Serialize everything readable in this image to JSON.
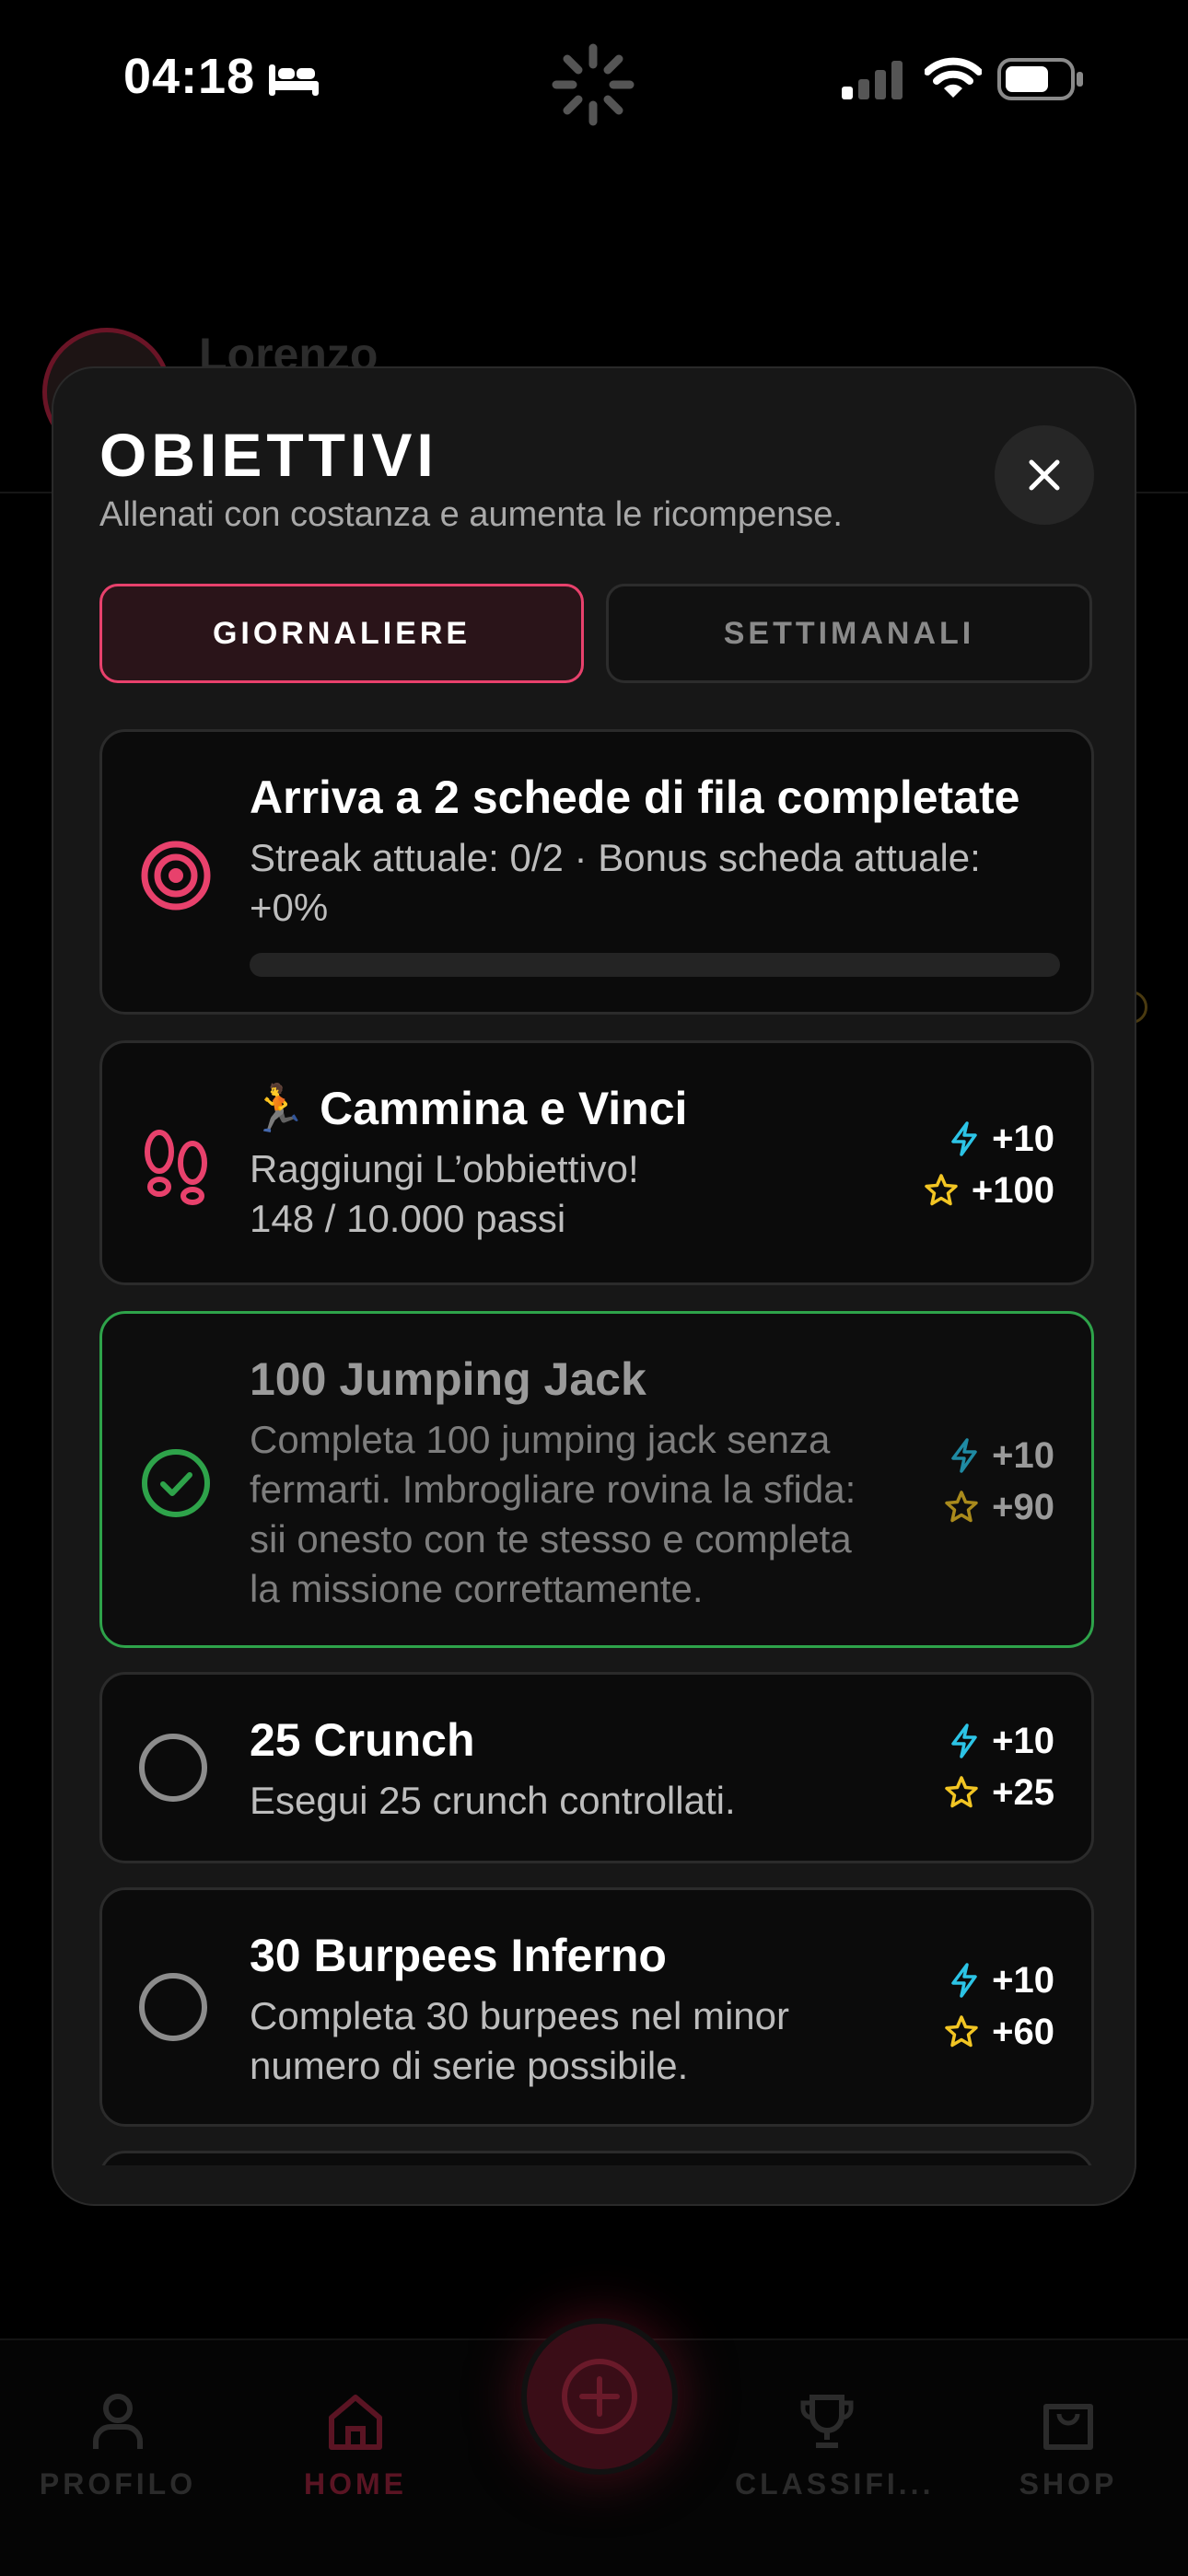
{
  "status_bar": {
    "time": "04:18"
  },
  "background": {
    "user_name": "Lorenzo"
  },
  "modal": {
    "title": "OBIETTIVI",
    "subtitle": "Allenati con costanza e aumenta le ricompense.",
    "tabs": [
      {
        "label": "GIORNALIERE",
        "active": true
      },
      {
        "label": "SETTIMANALI",
        "active": false
      }
    ],
    "goals": [
      {
        "title": "Arriva a 2 schede di fila completate",
        "desc_line1": "Streak attuale: 0/2 · Bonus scheda attuale:",
        "desc_line2": "+0%",
        "progress": 0,
        "icon": "target-icon"
      },
      {
        "emoji": "🏃",
        "title": "Cammina e Vinci",
        "desc_line1": "Raggiungi L’obbiettivo!",
        "desc_line2": "148 / 10.000 passi",
        "energy": "+10",
        "stars": "+100",
        "icon": "footsteps-icon"
      },
      {
        "title": "100 Jumping Jack",
        "desc_lines": [
          "Completa 100 jumping jack senza",
          "fermarti. Imbrogliare rovina la sfida:",
          "sii onesto con te stesso e completa",
          "la missione correttamente."
        ],
        "energy": "+10",
        "stars": "+90",
        "status": "completed",
        "icon": "check-circle-icon"
      },
      {
        "title": "25 Crunch",
        "desc_line1": "Esegui 25 crunch controllati.",
        "energy": "+10",
        "stars": "+25",
        "status": "pending"
      },
      {
        "title": "30 Burpees Inferno",
        "desc_line1": "Completa 30 burpees nel minor",
        "desc_line2": "numero di serie possibile.",
        "energy": "+10",
        "stars": "+60",
        "status": "pending"
      }
    ]
  },
  "nav": {
    "items": [
      "PROFILO",
      "HOME",
      "CLASSIFI...",
      "SHOP"
    ],
    "active": "HOME"
  },
  "colors": {
    "accent": "#e8416c",
    "success": "#2ea34a",
    "energy": "#2cc4e6",
    "star": "#f2c523"
  }
}
